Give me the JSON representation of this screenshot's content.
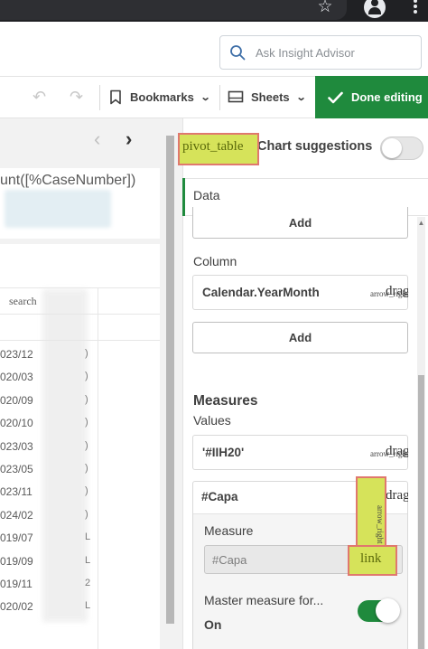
{
  "search": {
    "placeholder": "Ask Insight Advisor"
  },
  "toolbar": {
    "bookmarks_label": "Bookmarks",
    "sheets_label": "Sheets",
    "done_editing_label": "Done editing"
  },
  "canvas": {
    "kpi_title": "unt([%CaseNumber])",
    "table_header": "search",
    "rows": [
      {
        "date": "023/12",
        "val": ")"
      },
      {
        "date": "020/03",
        "val": ")"
      },
      {
        "date": "020/09",
        "val": ")"
      },
      {
        "date": "020/10",
        "val": ")"
      },
      {
        "date": "023/03",
        "val": ")"
      },
      {
        "date": "023/05",
        "val": ")"
      },
      {
        "date": "023/11",
        "val": ")"
      },
      {
        "date": "024/02",
        "val": ")"
      },
      {
        "date": "019/07",
        "val": "L"
      },
      {
        "date": "019/09",
        "val": "L"
      },
      {
        "date": "019/11",
        "val": "2"
      },
      {
        "date": "020/02",
        "val": "L"
      }
    ]
  },
  "panel": {
    "pivot_label": "pivot_table",
    "chart_suggestions": "Chart suggestions",
    "data_tab": "Data",
    "add_label": "Add",
    "column_heading": "Column",
    "column_field": "Calendar.YearMonth",
    "arrow_right_small": "arrow_right",
    "drag_text": "dragg",
    "measures_heading": "Measures",
    "values_heading": "Values",
    "iih_field": "'#IIH20'",
    "capa_title": "#Capa",
    "measure_label": "Measure",
    "measure_value": "#Capa",
    "arrow_right_vertical": "arrow_right",
    "link_label": "link",
    "master_label": "Master measure for...",
    "master_value": "On"
  },
  "colors": {
    "accent_green": "#1f8a3d",
    "annotation_fill": "#d6e35a",
    "annotation_border": "#e0786e"
  }
}
